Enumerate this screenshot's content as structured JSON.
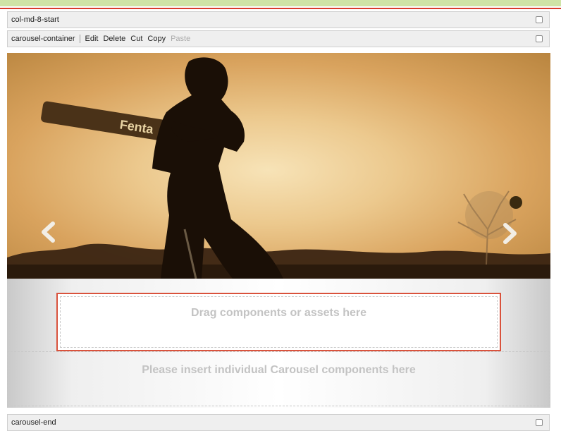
{
  "editor": {
    "bars": [
      {
        "label": "col-md-8-start"
      },
      {
        "label": "carousel-container"
      },
      {
        "label": "carousel-end"
      }
    ],
    "toolbar": {
      "edit": "Edit",
      "delete": "Delete",
      "cut": "Cut",
      "copy": "Copy",
      "paste": "Paste"
    },
    "carousel": {
      "bat_brand": "Fenta",
      "prev_icon": "chevron-left-icon",
      "next_icon": "chevron-right-icon"
    },
    "drop_zone": {
      "drag_text": "Drag components or assets here",
      "insert_text": "Please insert individual Carousel components here"
    },
    "colors": {
      "selection_border": "#d9523c",
      "top_band": "#cfe4a6"
    }
  }
}
